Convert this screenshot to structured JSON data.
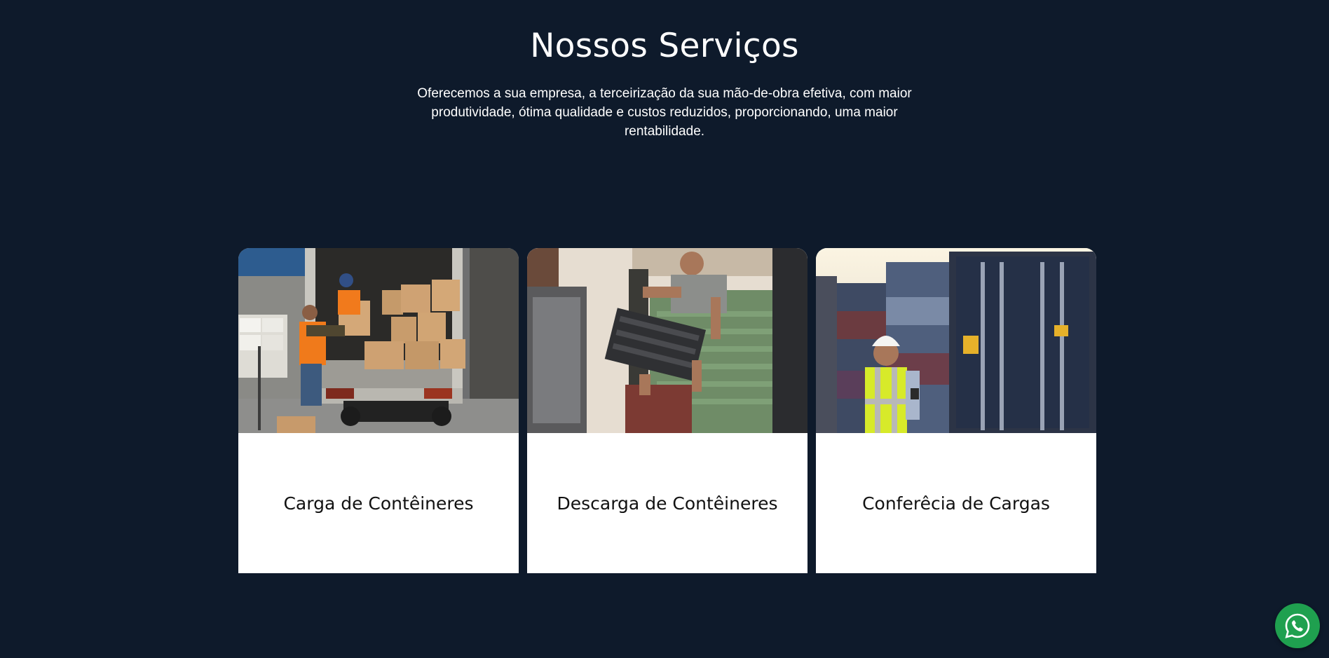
{
  "services": {
    "title": "Nossos Serviços",
    "subtitle": "Oferecemos a sua empresa, a terceirização da sua mão-de-obra efetiva, com maior produtividade, ótima qualidade e custos reduzidos, proporcionando, uma maior rentabilidade.",
    "cards": [
      {
        "label": "Carga de Contêineres"
      },
      {
        "label": "Descarga de Contêineres"
      },
      {
        "label": "Conferêcia de Cargas"
      }
    ]
  },
  "whatsapp": {
    "icon": "whatsapp-icon",
    "color": "#1fa04f"
  },
  "colors": {
    "background": "#0e1a2b",
    "card": "#ffffff"
  }
}
